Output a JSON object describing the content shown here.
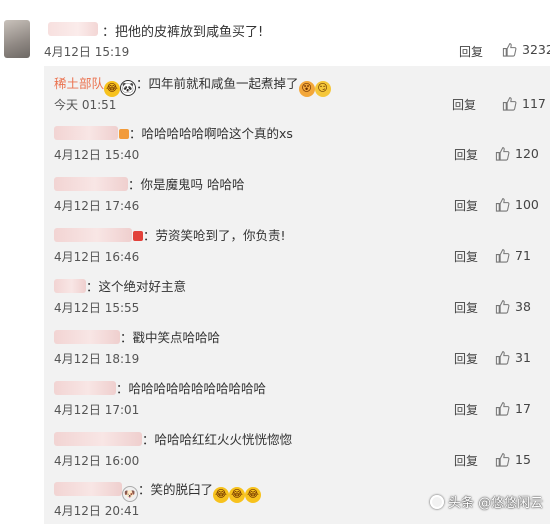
{
  "top_comment": {
    "text": "：把他的皮裤放到咸鱼买了!",
    "date": "4月12日 15:19",
    "reply": "回复",
    "likes": "3232"
  },
  "replies": [
    {
      "username": "稀土部队",
      "text": "：四年前就和咸鱼一起煮掉了",
      "date": "今天 01:51",
      "reply": "回复",
      "likes": "117",
      "blur_w": 0,
      "emojis_pre": [
        "laugh",
        "panda"
      ],
      "emojis_post": [
        "face",
        "smirk"
      ]
    },
    {
      "username": "",
      "text": "：哈哈哈哈哈啊哈这个真的xs",
      "date": "4月12日 15:40",
      "reply": "回复",
      "likes": "120",
      "blur_w": 64,
      "badge": "orange"
    },
    {
      "username": "",
      "text": "：你是魔鬼吗 哈哈哈",
      "date": "4月12日 17:46",
      "reply": "回复",
      "likes": "100",
      "blur_w": 74
    },
    {
      "username": "",
      "text": "：劳资笑呛到了，你负责!",
      "date": "4月12日 16:46",
      "reply": "回复",
      "likes": "71",
      "blur_w": 78,
      "badge": "red"
    },
    {
      "username": "",
      "text": "：这个绝对好主意",
      "date": "4月12日 15:55",
      "reply": "回复",
      "likes": "38",
      "blur_w": 32
    },
    {
      "username": "",
      "text": "：戳中笑点哈哈哈",
      "date": "4月12日 18:19",
      "reply": "回复",
      "likes": "31",
      "blur_w": 66
    },
    {
      "username": "",
      "text": "：哈哈哈哈哈哈哈哈哈哈哈",
      "date": "4月12日 17:01",
      "reply": "回复",
      "likes": "17",
      "blur_w": 62
    },
    {
      "username": "",
      "text": "：哈哈哈红红火火恍恍惚惚",
      "date": "4月12日 16:00",
      "reply": "回复",
      "likes": "15",
      "blur_w": 88
    },
    {
      "username": "",
      "text": "：笑的脱臼了",
      "date": "4月12日 20:41",
      "reply": "回复",
      "likes": "",
      "blur_w": 68,
      "emojis_pre": [
        "dog"
      ],
      "emojis_post": [
        "laugh",
        "laugh",
        "laugh"
      ]
    }
  ],
  "watermark": "头条 @悠悠闲云",
  "icons": {
    "like": "thumbs-up-icon"
  },
  "colors": {
    "panel_bg": "#f2f2f2",
    "username": "#eb7350"
  }
}
